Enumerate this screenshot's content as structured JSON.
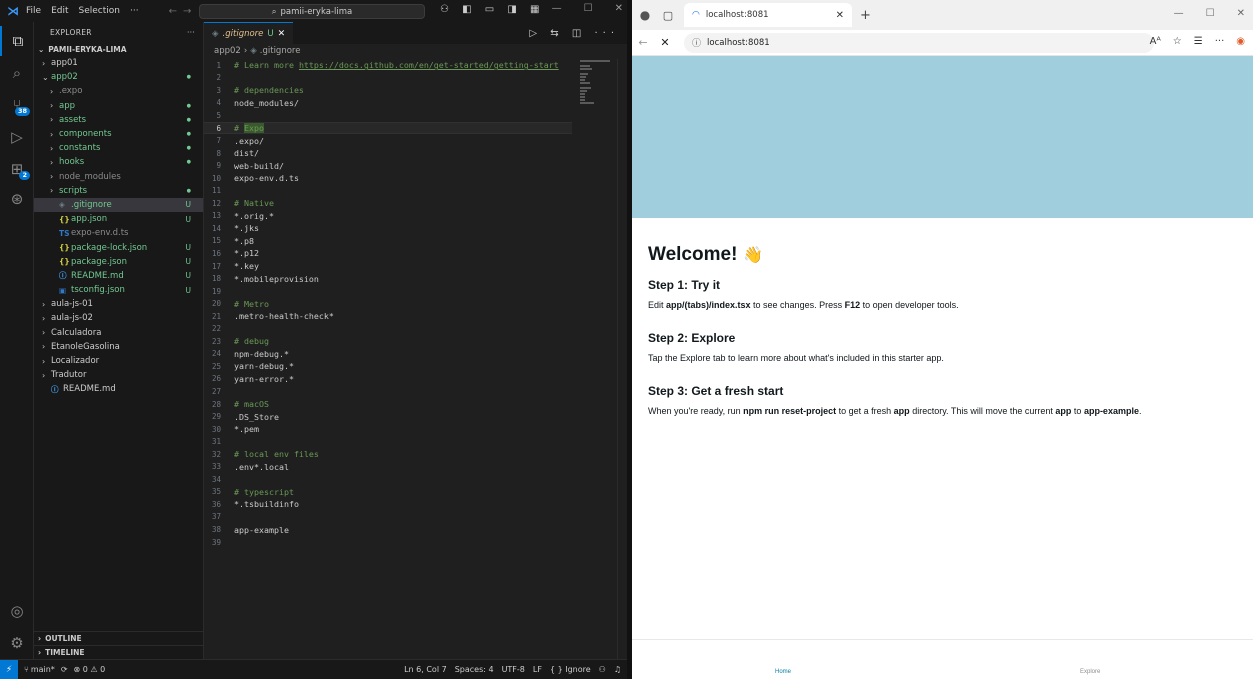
{
  "vscode": {
    "menu": [
      "File",
      "Edit",
      "Selection",
      "···"
    ],
    "search_label": "pamii-eryka-lima",
    "explorer": {
      "header": "EXPLORER",
      "more": "···",
      "root": "PAMII-ERYKA-LIMA",
      "items": [
        {
          "label": "app01",
          "twisty": "›",
          "indent": 0,
          "color": "white",
          "status": "",
          "icon": ""
        },
        {
          "label": "app02",
          "twisty": "⌄",
          "indent": 0,
          "color": "green",
          "status": "●",
          "icon": ""
        },
        {
          "label": ".expo",
          "twisty": "›",
          "indent": 1,
          "color": "gray",
          "status": "",
          "icon": ""
        },
        {
          "label": "app",
          "twisty": "›",
          "indent": 1,
          "color": "green",
          "status": "●",
          "icon": ""
        },
        {
          "label": "assets",
          "twisty": "›",
          "indent": 1,
          "color": "green",
          "status": "●",
          "icon": ""
        },
        {
          "label": "components",
          "twisty": "›",
          "indent": 1,
          "color": "green",
          "status": "●",
          "icon": ""
        },
        {
          "label": "constants",
          "twisty": "›",
          "indent": 1,
          "color": "green",
          "status": "●",
          "icon": ""
        },
        {
          "label": "hooks",
          "twisty": "›",
          "indent": 1,
          "color": "green",
          "status": "●",
          "icon": ""
        },
        {
          "label": "node_modules",
          "twisty": "›",
          "indent": 1,
          "color": "gray",
          "status": "",
          "icon": ""
        },
        {
          "label": "scripts",
          "twisty": "›",
          "indent": 1,
          "color": "green",
          "status": "●",
          "icon": ""
        },
        {
          "label": ".gitignore",
          "twisty": "",
          "indent": 1,
          "color": "green",
          "status": "U",
          "icon": "◈",
          "selected": true
        },
        {
          "label": "app.json",
          "twisty": "",
          "indent": 1,
          "color": "green",
          "status": "U",
          "icon": "{}"
        },
        {
          "label": "expo-env.d.ts",
          "twisty": "",
          "indent": 1,
          "color": "gray",
          "status": "",
          "icon": "TS"
        },
        {
          "label": "package-lock.json",
          "twisty": "",
          "indent": 1,
          "color": "green",
          "status": "U",
          "icon": "{}"
        },
        {
          "label": "package.json",
          "twisty": "",
          "indent": 1,
          "color": "green",
          "status": "U",
          "icon": "{}"
        },
        {
          "label": "README.md",
          "twisty": "",
          "indent": 1,
          "color": "green",
          "status": "U",
          "icon": "ⓘ"
        },
        {
          "label": "tsconfig.json",
          "twisty": "",
          "indent": 1,
          "color": "green",
          "status": "U",
          "icon": "▣"
        },
        {
          "label": "aula-js-01",
          "twisty": "›",
          "indent": 0,
          "color": "white",
          "status": "",
          "icon": ""
        },
        {
          "label": "aula-js-02",
          "twisty": "›",
          "indent": 0,
          "color": "white",
          "status": "",
          "icon": ""
        },
        {
          "label": "Calculadora",
          "twisty": "›",
          "indent": 0,
          "color": "white",
          "status": "",
          "icon": ""
        },
        {
          "label": "EtanoleGasolina",
          "twisty": "›",
          "indent": 0,
          "color": "white",
          "status": "",
          "icon": ""
        },
        {
          "label": "Localizador",
          "twisty": "›",
          "indent": 0,
          "color": "white",
          "status": "",
          "icon": ""
        },
        {
          "label": "Tradutor",
          "twisty": "›",
          "indent": 0,
          "color": "white",
          "status": "",
          "icon": ""
        },
        {
          "label": "README.md",
          "twisty": "",
          "indent": 0,
          "color": "white",
          "status": "",
          "icon": "ⓘ"
        }
      ],
      "outline": "OUTLINE",
      "timeline": "TIMELINE"
    },
    "activity_badges": {
      "scm": "38",
      "extensions": "2"
    },
    "tab": {
      "label": ".gitignore",
      "modified": "U",
      "close": "✕"
    },
    "breadcrumb": {
      "folder": "app02",
      "sep": "›",
      "file": ".gitignore"
    },
    "code_lines": [
      {
        "n": "1",
        "text": "# Learn more ",
        "link": "https://docs.github.com/en/get-started/getting-start",
        "comment": true
      },
      {
        "n": "2",
        "text": ""
      },
      {
        "n": "3",
        "text": "# dependencies",
        "comment": true
      },
      {
        "n": "4",
        "text": "node_modules/"
      },
      {
        "n": "5",
        "text": ""
      },
      {
        "n": "6",
        "text": "# ",
        "sel": "Expo",
        "comment": true,
        "current": true
      },
      {
        "n": "7",
        "text": ".expo/"
      },
      {
        "n": "8",
        "text": "dist/"
      },
      {
        "n": "9",
        "text": "web-build/"
      },
      {
        "n": "10",
        "text": "expo-env.d.ts"
      },
      {
        "n": "11",
        "text": ""
      },
      {
        "n": "12",
        "text": "# Native",
        "comment": true
      },
      {
        "n": "13",
        "text": "*.orig.*"
      },
      {
        "n": "14",
        "text": "*.jks"
      },
      {
        "n": "15",
        "text": "*.p8"
      },
      {
        "n": "16",
        "text": "*.p12"
      },
      {
        "n": "17",
        "text": "*.key"
      },
      {
        "n": "18",
        "text": "*.mobileprovision"
      },
      {
        "n": "19",
        "text": ""
      },
      {
        "n": "20",
        "text": "# Metro",
        "comment": true
      },
      {
        "n": "21",
        "text": ".metro-health-check*"
      },
      {
        "n": "22",
        "text": ""
      },
      {
        "n": "23",
        "text": "# debug",
        "comment": true
      },
      {
        "n": "24",
        "text": "npm-debug.*"
      },
      {
        "n": "25",
        "text": "yarn-debug.*"
      },
      {
        "n": "26",
        "text": "yarn-error.*"
      },
      {
        "n": "27",
        "text": ""
      },
      {
        "n": "28",
        "text": "# macOS",
        "comment": true
      },
      {
        "n": "29",
        "text": ".DS_Store"
      },
      {
        "n": "30",
        "text": "*.pem"
      },
      {
        "n": "31",
        "text": ""
      },
      {
        "n": "32",
        "text": "# local env files",
        "comment": true
      },
      {
        "n": "33",
        "text": ".env*.local"
      },
      {
        "n": "34",
        "text": ""
      },
      {
        "n": "35",
        "text": "# typescript",
        "comment": true
      },
      {
        "n": "36",
        "text": "*.tsbuildinfo"
      },
      {
        "n": "37",
        "text": ""
      },
      {
        "n": "38",
        "text": "app-example"
      },
      {
        "n": "39",
        "text": ""
      }
    ],
    "statusbar": {
      "branch": "main*",
      "sync": "⟳",
      "problems": "⊗ 0 ⚠ 0",
      "position": "Ln 6, Col 7",
      "spaces": "Spaces: 4",
      "encoding": "UTF-8",
      "eol": "LF",
      "language": "{ } Ignore"
    }
  },
  "browser": {
    "tab_title": "localhost:8081",
    "url": "localhost:8081",
    "page": {
      "welcome": "Welcome!",
      "wave": "👋",
      "step1_title": "Step 1: Try it",
      "step1_pre": "Edit ",
      "step1_bold1": "app/(tabs)/index.tsx",
      "step1_mid": " to see changes. Press ",
      "step1_bold2": "F12",
      "step1_post": " to open developer tools.",
      "step2_title": "Step 2: Explore",
      "step2_text": "Tap the Explore tab to learn more about what's included in this starter app.",
      "step3_title": "Step 3: Get a fresh start",
      "step3_pre": "When you're ready, run ",
      "step3_bold1": "npm run reset-project",
      "step3_mid1": " to get a fresh ",
      "step3_bold2": "app",
      "step3_mid2": " directory. This will move the current ",
      "step3_bold3": "app",
      "step3_mid3": " to ",
      "step3_bold4": "app-example",
      "step3_post": ".",
      "tab_home": "Home",
      "tab_explore": "Explore"
    }
  },
  "colors": {
    "accent": "#0078d4",
    "git_untracked": "#73c991",
    "hero": "#a1cedc",
    "active_tab_link": "#0a7ea4"
  }
}
